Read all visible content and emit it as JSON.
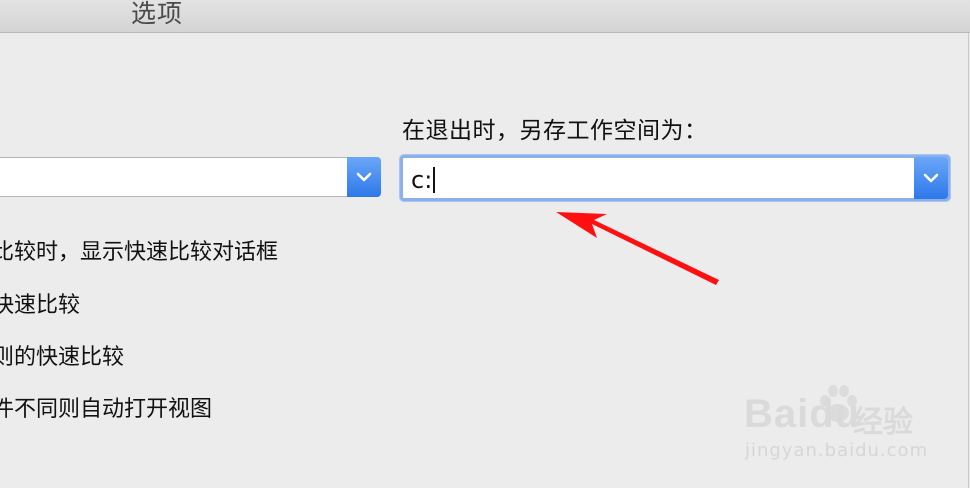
{
  "window": {
    "title": "选项"
  },
  "left": {
    "label": "：",
    "combo_value": "",
    "options": [
      "比较时，显示快速比较对话框",
      "快速比较",
      "则的快速比较",
      "件不同则自动打开视图"
    ]
  },
  "right": {
    "label": "在退出时，另存工作空间为：",
    "combo_value": "c:"
  },
  "watermark": {
    "brand": "Baidu",
    "cn": "经验",
    "url": "jingyan.baidu.com"
  },
  "colors": {
    "accent": "#2d78ea",
    "focus_ring": "#8cb0ec",
    "annotation_arrow": "#ff1010"
  },
  "icons": {
    "combo_button": "chevron-down-icon",
    "annotation": "red-arrow-icon",
    "watermark": "baidu-paw-icon"
  }
}
